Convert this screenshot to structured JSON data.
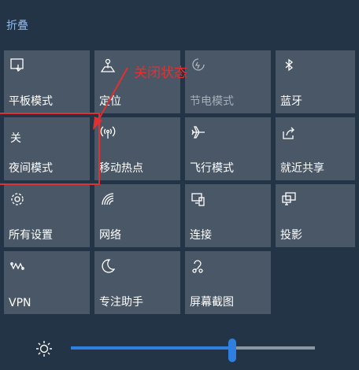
{
  "header": {
    "collapse_label": "折叠"
  },
  "tiles": [
    {
      "label": "平板模式",
      "icon": "tablet-mode-icon",
      "state": "on"
    },
    {
      "label": "定位",
      "icon": "location-icon",
      "state": "on"
    },
    {
      "label": "节电模式",
      "icon": "battery-saver-icon",
      "state": "disabled"
    },
    {
      "label": "蓝牙",
      "icon": "bluetooth-icon",
      "state": "on"
    },
    {
      "label": "夜间模式",
      "icon": "night-light-icon",
      "state": "off",
      "state_text": "关"
    },
    {
      "label": "移动热点",
      "icon": "mobile-hotspot-icon",
      "state": "on"
    },
    {
      "label": "飞行模式",
      "icon": "airplane-icon",
      "state": "on"
    },
    {
      "label": "就近共享",
      "icon": "nearby-share-icon",
      "state": "on"
    },
    {
      "label": "所有设置",
      "icon": "gear-icon",
      "state": "on"
    },
    {
      "label": "网络",
      "icon": "network-icon",
      "state": "on"
    },
    {
      "label": "连接",
      "icon": "connect-icon",
      "state": "on"
    },
    {
      "label": "投影",
      "icon": "project-icon",
      "state": "on"
    },
    {
      "label": "VPN",
      "icon": "vpn-icon",
      "state": "on"
    },
    {
      "label": "专注助手",
      "icon": "moon-icon",
      "state": "on"
    },
    {
      "label": "屏幕截图",
      "icon": "screen-snip-icon",
      "state": "on"
    }
  ],
  "annotation": {
    "text": "关闭状态",
    "color": "#e53030"
  },
  "brightness": {
    "icon": "brightness-icon",
    "level_percent": 66,
    "accent": "#2f7fe0"
  }
}
